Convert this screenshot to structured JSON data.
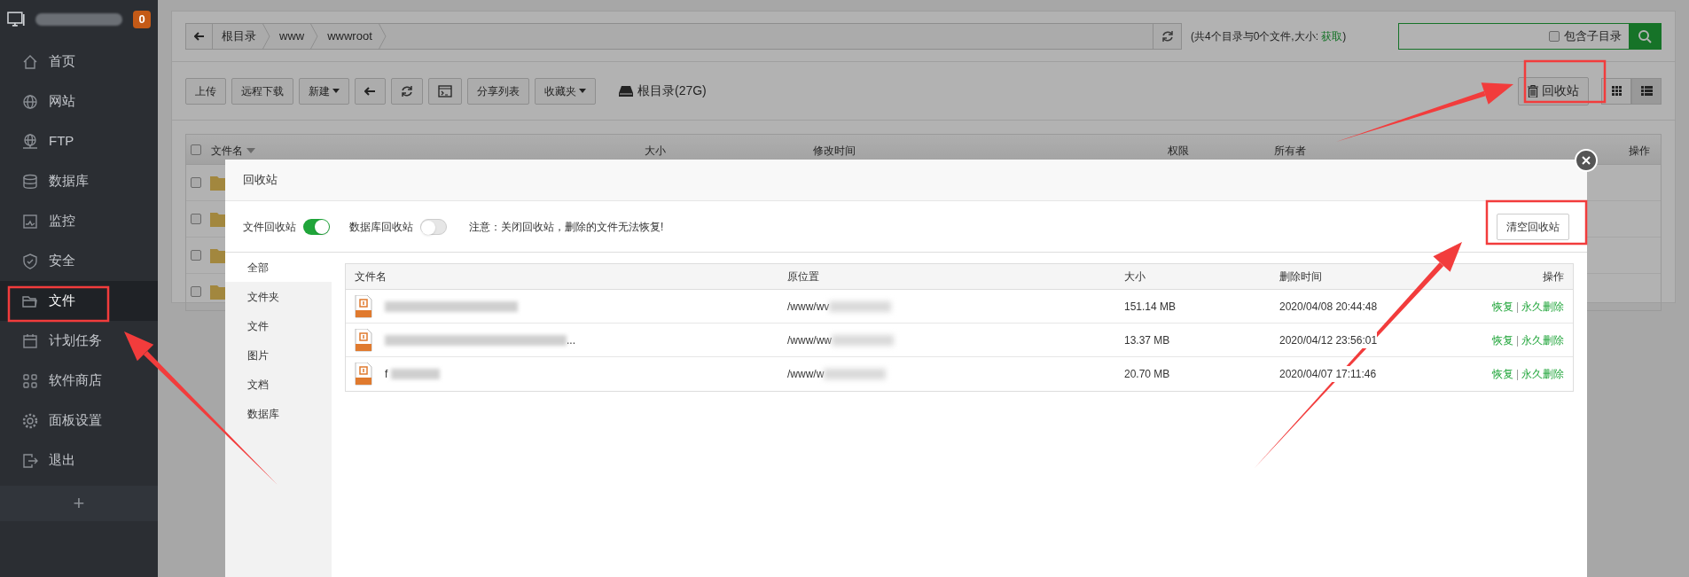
{
  "sidebar": {
    "badge": "0",
    "items": [
      {
        "label": "首页",
        "selected": false
      },
      {
        "label": "网站",
        "selected": false
      },
      {
        "label": "FTP",
        "selected": false
      },
      {
        "label": "数据库",
        "selected": false
      },
      {
        "label": "监控",
        "selected": false
      },
      {
        "label": "安全",
        "selected": false
      },
      {
        "label": "文件",
        "selected": true
      },
      {
        "label": "计划任务",
        "selected": false
      },
      {
        "label": "软件商店",
        "selected": false
      },
      {
        "label": "面板设置",
        "selected": false
      },
      {
        "label": "退出",
        "selected": false
      }
    ],
    "add_button": "+"
  },
  "path_bar": {
    "crumbs": [
      "根目录",
      "www",
      "wwwroot"
    ],
    "summary_prefix": "(共4个目录与0个文件,大小: ",
    "summary_link": "获取",
    "summary_suffix": ")"
  },
  "search": {
    "option": {
      "label": "包含子目录",
      "checked": false
    }
  },
  "toolbar": {
    "buttons": [
      {
        "kind": "text",
        "label": "上传",
        "dropdown": false
      },
      {
        "kind": "text",
        "label": "远程下载",
        "dropdown": false
      },
      {
        "kind": "text",
        "label": "新建",
        "dropdown": true
      },
      {
        "kind": "back"
      },
      {
        "kind": "refresh"
      },
      {
        "kind": "terminal"
      },
      {
        "kind": "text",
        "label": "分享列表",
        "dropdown": false
      },
      {
        "kind": "text",
        "label": "收藏夹",
        "dropdown": true
      }
    ],
    "disk": "根目录(27G)",
    "recycle_button": "回收站",
    "views": [
      {
        "kind": "grid",
        "selected": false
      },
      {
        "kind": "list",
        "selected": true
      }
    ]
  },
  "file_table": {
    "select_all": {
      "checked": false
    },
    "columns": [
      "文件名",
      "大小",
      "修改时间",
      "权限",
      "所有者",
      "操作"
    ],
    "rows": [
      {
        "checked": false
      },
      {
        "checked": false
      },
      {
        "checked": false
      },
      {
        "checked": false
      }
    ]
  },
  "dialog": {
    "title": "回收站",
    "toggles": [
      {
        "label": "文件回收站",
        "on": true
      },
      {
        "label": "数据库回收站",
        "on": false
      }
    ],
    "note": "注意：关闭回收站，删除的文件无法恢复!",
    "clear_button": "清空回收站",
    "nav": [
      {
        "label": "全部",
        "selected": true
      },
      {
        "label": "文件夹",
        "selected": false
      },
      {
        "label": "文件",
        "selected": false
      },
      {
        "label": "图片",
        "selected": false
      },
      {
        "label": "文档",
        "selected": false
      },
      {
        "label": "数据库",
        "selected": false
      }
    ],
    "columns": [
      "文件名",
      "原位置",
      "大小",
      "删除时间",
      "操作"
    ],
    "rows": [
      {
        "location": "/www/wv",
        "size": "151.14 MB",
        "deleted": "2020/04/08 20:44:48",
        "actions": [
          "恢复",
          "永久删除"
        ],
        "separator": "|"
      },
      {
        "name_suffix": "...",
        "location": "/www/ww",
        "size": "13.37 MB",
        "deleted": "2020/04/12 23:56:01",
        "actions": [
          "恢复",
          "永久删除"
        ],
        "separator": "|"
      },
      {
        "name_prefix": "f",
        "location": "/www/w",
        "size": "20.70 MB",
        "deleted": "2020/04/07 17:11:46",
        "actions": [
          "恢复",
          "永久删除"
        ],
        "separator": "|"
      }
    ]
  }
}
